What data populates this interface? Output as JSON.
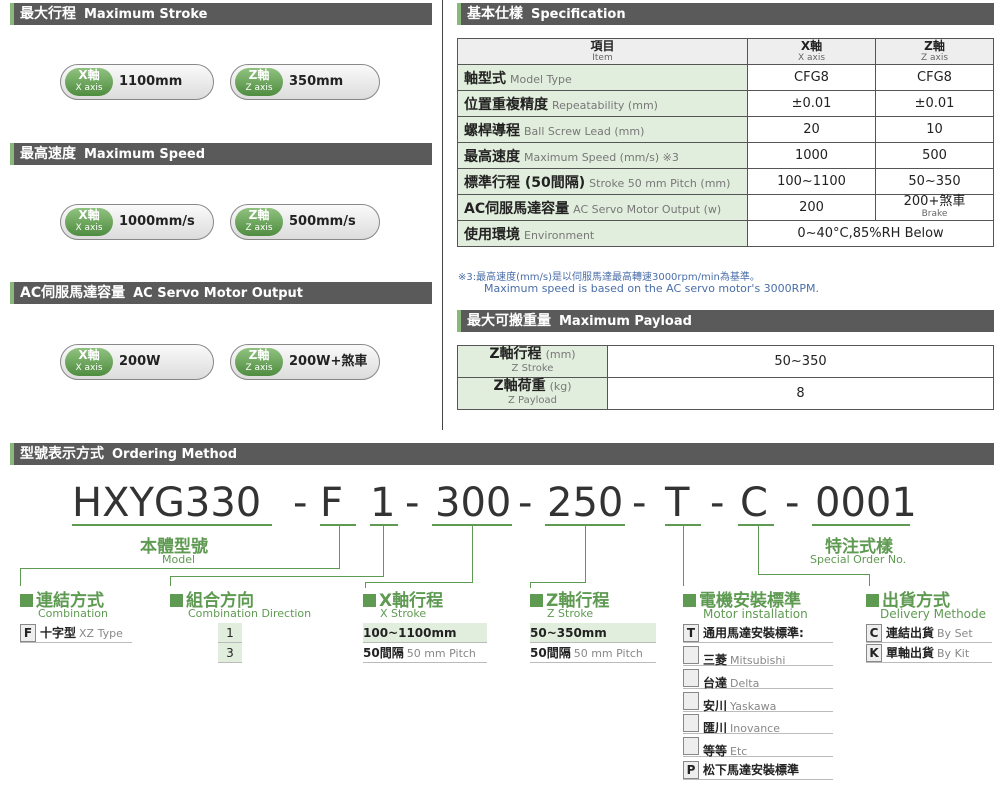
{
  "stroke": {
    "title_cn": "最大行程",
    "title_en": "Maximum Stroke",
    "x_cn": "X軸",
    "x_en": "X axis",
    "x_val": "1100mm",
    "z_cn": "Z軸",
    "z_en": "Z axis",
    "z_val": "350mm"
  },
  "speed": {
    "title_cn": "最高速度",
    "title_en": "Maximum Speed",
    "x_val": "1000mm/s",
    "z_val": "500mm/s"
  },
  "motor": {
    "title_cn": "AC伺服馬達容量",
    "title_en": "AC Servo Motor Output",
    "x_val": "200W",
    "z_val": "200W+煞車"
  },
  "spec": {
    "title_cn": "基本仕樣",
    "title_en": "Specification",
    "h_item_cn": "項目",
    "h_item_en": "Item",
    "h_x_cn": "X軸",
    "h_x_en": "X axis",
    "h_z_cn": "Z軸",
    "h_z_en": "Z axis",
    "rows": [
      {
        "cn": "軸型式",
        "en": "Model Type",
        "x": "CFG8",
        "z": "CFG8"
      },
      {
        "cn": "位置重複精度",
        "en": "Repeatability (mm)",
        "x": "±0.01",
        "z": "±0.01"
      },
      {
        "cn": "螺桿導程",
        "en": "Ball Screw Lead (mm)",
        "x": "20",
        "z": "10"
      },
      {
        "cn": "最高速度",
        "en": "Maximum Speed (mm/s) ※3",
        "x": "1000",
        "z": "500"
      },
      {
        "cn": "標準行程 (50間隔)",
        "en": "Stroke 50 mm Pitch (mm)",
        "x": "100~1100",
        "z": "50~350"
      },
      {
        "cn": "AC伺服馬達容量",
        "en": "AC Servo Motor Output (w)",
        "x": "200",
        "z": "200+煞車",
        "z_sub": "Brake"
      },
      {
        "cn": "使用環境",
        "en": "Environment",
        "both": "0~40°C,85%RH Below"
      }
    ],
    "note1": "※3:最高速度(mm/s)是以伺服馬達最高轉速3000rpm/min為基準。",
    "note2": "Maximum speed is based on the AC servo motor's 3000RPM."
  },
  "payload": {
    "title_cn": "最大可搬重量",
    "title_en": "Maximum Payload",
    "r1_cn": "Z軸行程",
    "r1_en": "Z Stroke",
    "r1_unit": "(mm)",
    "r1_val": "50~350",
    "r2_cn": "Z軸荷重",
    "r2_en": "Z Payload",
    "r2_unit": "(kg)",
    "r2_val": "8"
  },
  "ordering": {
    "title_cn": "型號表示方式",
    "title_en": "Ordering Method",
    "code": [
      "HXYG330",
      "-",
      "F",
      "1",
      "-",
      "300",
      "-",
      "250",
      "-",
      "T",
      "-",
      "C",
      "-",
      "0001"
    ],
    "model_cn": "本體型號",
    "model_en": "Model",
    "special_cn": "特注式樣",
    "special_en": "Special Order No.",
    "comb_cn": "連結方式",
    "comb_en": "Combination",
    "comb_k": "F",
    "comb_v": "十字型",
    "comb_e": "XZ Type",
    "dir_cn": "組合方向",
    "dir_en": "Combination Direction",
    "dir_1": "1",
    "dir_3": "3",
    "xs_cn": "X軸行程",
    "xs_en": "X Stroke",
    "xs_r1": "100~1100mm",
    "xs_r2": "50間隔",
    "xs_r2e": "50 mm Pitch",
    "zs_cn": "Z軸行程",
    "zs_en": "Z Stroke",
    "zs_r1": "50~350mm",
    "zs_r2": "50間隔",
    "zs_r2e": "50 mm Pitch",
    "mi_cn": "電機安裝標準",
    "mi_en": "Motor installation",
    "mi_rows": [
      {
        "k": "T",
        "v": "通用馬達安裝標準:",
        "e": ""
      },
      {
        "k": "",
        "v": "三菱",
        "e": "Mitsubishi"
      },
      {
        "k": "",
        "v": "台達",
        "e": "Delta"
      },
      {
        "k": "",
        "v": "安川",
        "e": "Yaskawa"
      },
      {
        "k": "",
        "v": "匯川",
        "e": "Inovance"
      },
      {
        "k": "",
        "v": "等等",
        "e": "Etc"
      },
      {
        "k": "P",
        "v": "松下馬達安裝標準",
        "e": ""
      }
    ],
    "dl_cn": "出貨方式",
    "dl_en": "Delivery Methode",
    "dl_rows": [
      {
        "k": "C",
        "v": "連結出貨",
        "e": "By Set"
      },
      {
        "k": "K",
        "v": "單軸出貨",
        "e": "By Kit"
      }
    ]
  }
}
